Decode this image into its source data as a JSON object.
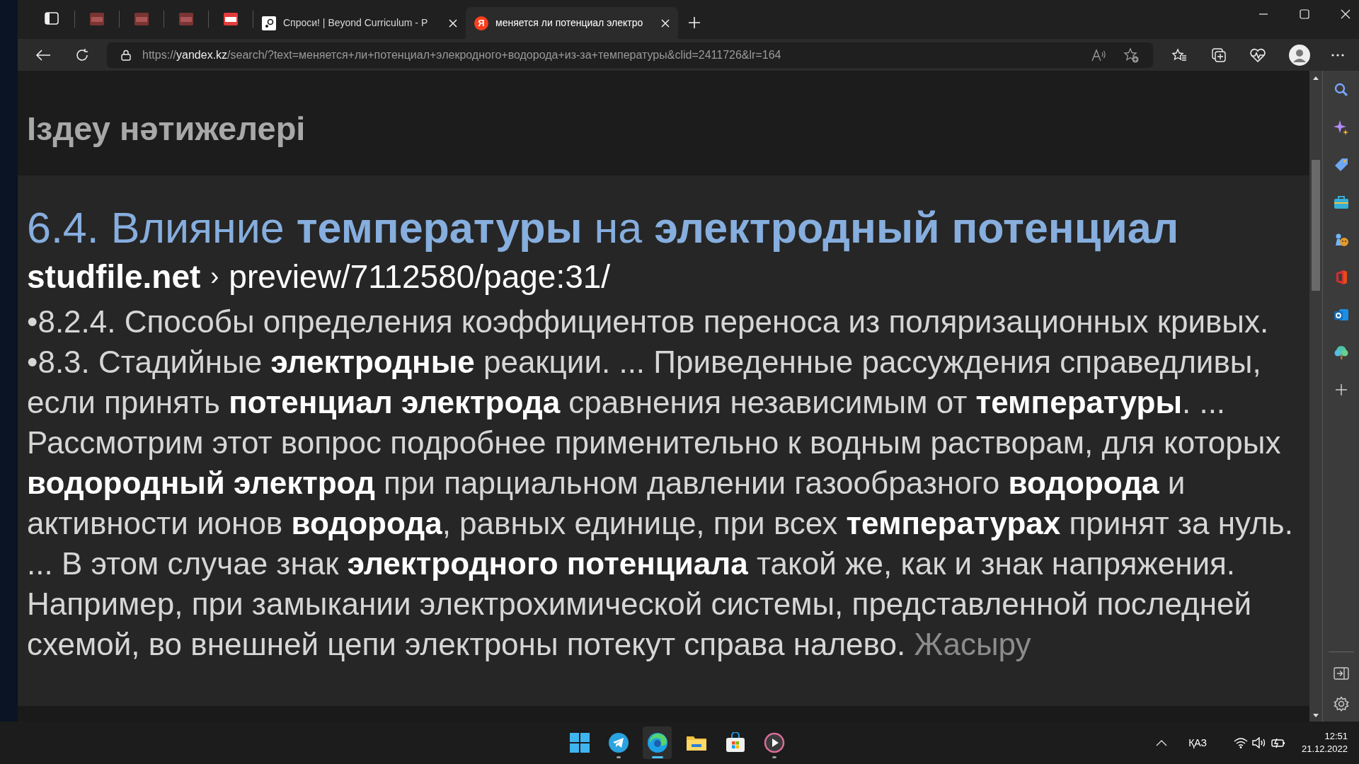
{
  "tabs": [
    {
      "kind": "pdf",
      "dim": true,
      "selected": false
    },
    {
      "kind": "pdf",
      "dim": true,
      "selected": false
    },
    {
      "kind": "pdf",
      "dim": true,
      "selected": false
    },
    {
      "kind": "pdf",
      "dim": false,
      "selected": false
    },
    {
      "kind": "site",
      "label": "Спроси! | Beyond Curriculum - P",
      "selected": false
    },
    {
      "kind": "search",
      "favicon_text": "Я",
      "label": "меняется ли потенциал электро",
      "selected": true
    }
  ],
  "address": {
    "scheme": "https://",
    "host": "yandex.kz",
    "path": "/search/?text=меняется+ли+потенциал+элекродного+водорода+из-за+температуры&clid=2411726&lr=164"
  },
  "page": {
    "heading": "Іздеу нәтижелері",
    "result": {
      "title": "6.4. Влияние **температуры** на **электродный потенциал**",
      "site": "studfile.net",
      "separator": "›",
      "path": "preview/7112580/page:31/",
      "snippet": [
        "•8.2.4. Способы определения коэффициентов переноса из поляризационных кривых.",
        "•8.3. Стадийные **электродные** реакции. ... Приведенные рассуждения справедливы, если принять **потенциал электрода** сравнения независимым от **температуры**. ... Рассмотрим этот вопрос подробнее применительно к водным растворам, для которых **водородный электрод** при парциальном давлении газообразного **водорода** и активности ионов **водорода**, равных единице, при всех **температурах** принят за нуль. ... В этом случае знак **электродного потенциала** такой же, как и знак напряжения. Например, при замыкании электрохимической системы, представленной последней схемой, во внешней цепи электроны потекут справа налево."
      ],
      "hide_link": "Жасыру"
    }
  },
  "taskbar": {
    "apps": [
      {
        "kind": "start",
        "running": false,
        "active": false
      },
      {
        "kind": "telegram",
        "running": true,
        "active": false
      },
      {
        "kind": "edge",
        "running": true,
        "active": true
      },
      {
        "kind": "explorer",
        "running": false,
        "active": false
      },
      {
        "kind": "store",
        "running": false,
        "active": false
      },
      {
        "kind": "player",
        "running": true,
        "active": false
      }
    ],
    "language": "ҚАЗ",
    "time": "12:51",
    "date": "21.12.2022"
  }
}
